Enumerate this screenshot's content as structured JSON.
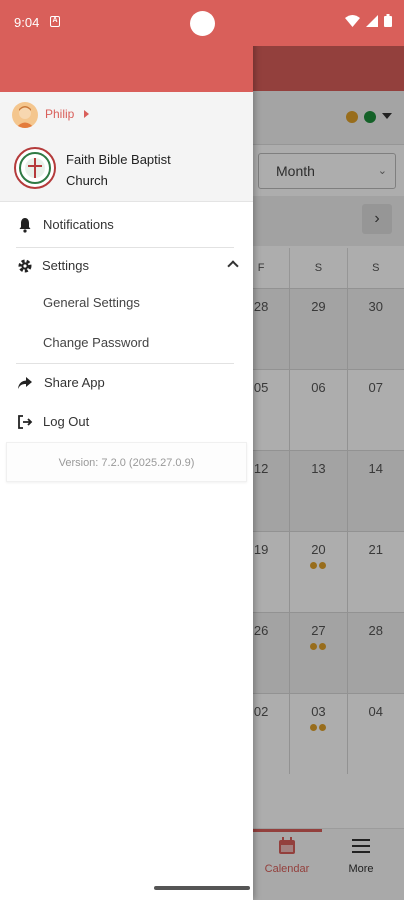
{
  "status_bar": {
    "time": "9:04",
    "notification_letter": "A"
  },
  "background": {
    "view_select": "Month",
    "colors": {
      "accent": "#d95f5a",
      "dot_orange": "#e0a12a",
      "dot_green": "#1e8f3c"
    },
    "weekday_headers": [
      "F",
      "S",
      "S"
    ],
    "weeks": [
      [
        {
          "d": "28",
          "ev": 0
        },
        {
          "d": "29",
          "ev": 0
        },
        {
          "d": "30",
          "ev": 0
        }
      ],
      [
        {
          "d": "05",
          "ev": 0
        },
        {
          "d": "06",
          "ev": 0
        },
        {
          "d": "07",
          "ev": 0
        }
      ],
      [
        {
          "d": "12",
          "ev": 0
        },
        {
          "d": "13",
          "ev": 0
        },
        {
          "d": "14",
          "ev": 0
        }
      ],
      [
        {
          "d": "19",
          "ev": 0
        },
        {
          "d": "20",
          "ev": 2
        },
        {
          "d": "21",
          "ev": 0
        }
      ],
      [
        {
          "d": "26",
          "ev": 0
        },
        {
          "d": "27",
          "ev": 2
        },
        {
          "d": "28",
          "ev": 0
        }
      ],
      [
        {
          "d": "02",
          "ev": 0
        },
        {
          "d": "03",
          "ev": 2
        },
        {
          "d": "04",
          "ev": 0
        }
      ]
    ],
    "bottom_nav": {
      "calendar": "Calendar",
      "more": "More"
    }
  },
  "drawer": {
    "user_name": "Philip",
    "church_name": "Faith Bible Baptist Church",
    "menu": {
      "notifications": "Notifications",
      "settings": "Settings",
      "general_settings": "General Settings",
      "change_password": "Change Password",
      "share_app": "Share App",
      "log_out": "Log Out"
    },
    "version": "Version: 7.2.0 (2025.27.0.9)"
  }
}
